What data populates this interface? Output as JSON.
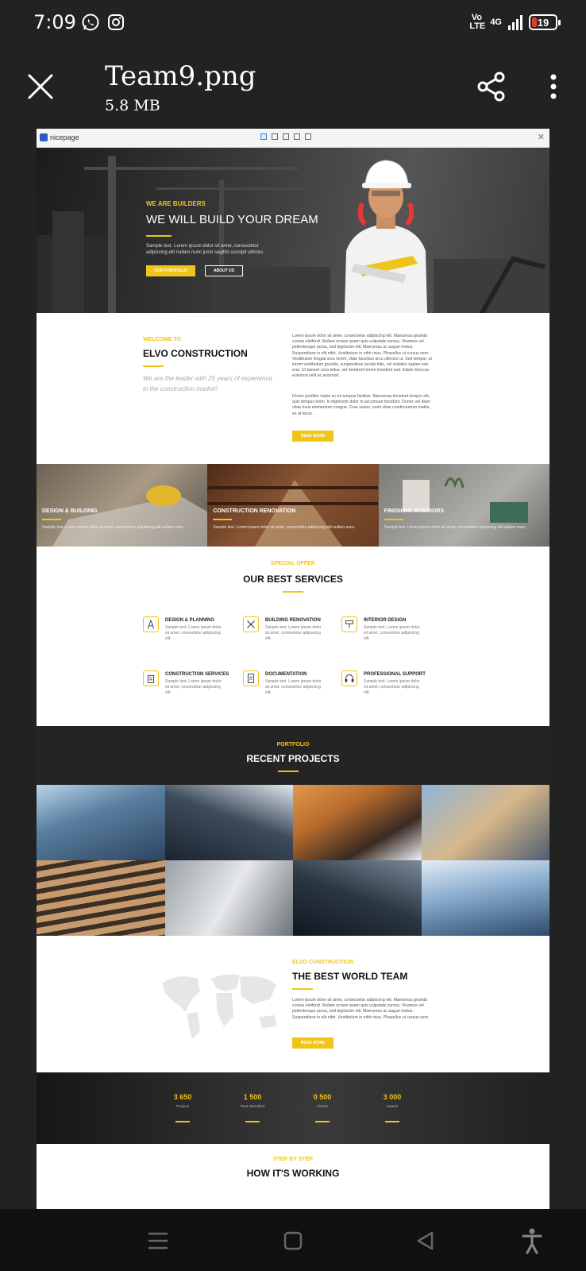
{
  "status_bar": {
    "time": "7:09",
    "volte": "Vo LTE",
    "network": "4G",
    "battery": "19"
  },
  "header": {
    "file_name": "Team9.png",
    "file_size": "5.8 MB"
  },
  "screenshot": {
    "builder_logo": "nicepage",
    "hero": {
      "eyebrow": "WE ARE BUILDERS",
      "title": "WE WILL BUILD YOUR DREAM",
      "text": "Sample text. Lorem ipsum dolor sit amet, consectetur adipiscing elit nullam nunc justo sagittis suscipit ultrices.",
      "button_primary": "OUR PORTFOLIO",
      "button_secondary": "ABOUT US"
    },
    "welcome": {
      "eyebrow": "WELCOME TO",
      "title": "ELVO CONSTRUCTION",
      "tagline": "We are the leader with 25 years of experience in the construction market!",
      "para1": "Lorem ipsum dolor sit amet, consectetur adipiscing elit. Maecenas gravida cursus eleifend. Nullam ornare quam quis vulputate cursus. Vivamus vel pellentesque purus, sed dignissim elit. Maecenas ac augue metus. Suspendisse in elit nibh. Vestibulum in nibh risus. Phasellus ut cursus sem. Vestibulum feugiat arcu lorem, vitae faucibus arcu ultricies ut. Sed tempor, ut lorem vestibulum gravida, suspendisse iaculis felis, vel sodales sapien non erat. Ut laoreet urna tellus, vel hendrerit lorem tincidunt sed. Etiam rhoncus euismod velit ac euismod.",
      "para2": "Donec porttitor turpis ac mi tempus facilisis. Maecenas tincidunt tempor elit, quis tempus enim. In dignissim dolor in accumsan tincidunt. Donec vel diam vitae risus elementum congue. Cras varius, enim vitae condimentum mattis, ex at lacus.",
      "button": "READ MORE"
    },
    "tiles": [
      {
        "title": "DESIGN & BUILDING",
        "text": "Sample text. Lorem ipsum dolor sit amet, consectetur adipiscing elit nullam nunc."
      },
      {
        "title": "CONSTRUCTION RENOVATION",
        "text": "Sample text. Lorem ipsum dolor sit amet, consectetur adipiscing elit nullam nunc."
      },
      {
        "title": "FINISHING INTERIORS",
        "text": "Sample text. Lorem ipsum dolor sit amet, consectetur adipiscing elit nullam nunc."
      }
    ],
    "services": {
      "eyebrow": "SPECIAL OFFER",
      "title": "OUR BEST SERVICES",
      "items": [
        {
          "title": "DESIGN & PLANNING",
          "text": "Sample text. Lorem ipsum dolor sit amet, consectetur adipiscing elit.",
          "icon": "compass-icon"
        },
        {
          "title": "BUILDING RENOVATION",
          "text": "Sample text. Lorem ipsum dolor sit amet, consectetur adipiscing elit.",
          "icon": "tools-icon"
        },
        {
          "title": "INTERIOR DESIGN",
          "text": "Sample text. Lorem ipsum dolor sit amet, consectetur adipiscing elit.",
          "icon": "paint-roller-icon"
        },
        {
          "title": "CONSTRUCTION SERVICES",
          "text": "Sample text. Lorem ipsum dolor sit amet, consectetur adipiscing elit.",
          "icon": "building-icon"
        },
        {
          "title": "DOCUMENTATION",
          "text": "Sample text. Lorem ipsum dolor sit amet, consectetur adipiscing elit.",
          "icon": "document-icon"
        },
        {
          "title": "PROFESSIONAL SUPPORT",
          "text": "Sample text. Lorem ipsum dolor sit amet, consectetur adipiscing elit.",
          "icon": "headset-icon"
        }
      ]
    },
    "portfolio": {
      "eyebrow": "PORTFOLIO",
      "title": "RECENT PROJECTS"
    },
    "team": {
      "eyebrow": "ELVO CONSTRUCTION",
      "title": "THE BEST WORLD TEAM",
      "text": "Lorem ipsum dolor sit amet, consectetur adipiscing elit. Maecenas gravida cursus eleifend. Nullam ornare quam quis vulputate cursus. Vivamus vel pellentesque purus, sed dignissim elit. Maecenas ac augue metus. Suspendisse in elit nibh. Vestibulum in nibh risus. Phasellus ut cursus sem.",
      "button": "READ MORE"
    },
    "stats": [
      {
        "value": "3 650",
        "label": "Projects"
      },
      {
        "value": "1 500",
        "label": "Team Members"
      },
      {
        "value": "0 500",
        "label": "Clients"
      },
      {
        "value": "3 000",
        "label": "Awards"
      }
    ],
    "how": {
      "eyebrow": "STEP BY STEP",
      "title": "HOW IT'S WORKING"
    }
  },
  "colors": {
    "accent": "#f0c419",
    "background": "#222222"
  }
}
